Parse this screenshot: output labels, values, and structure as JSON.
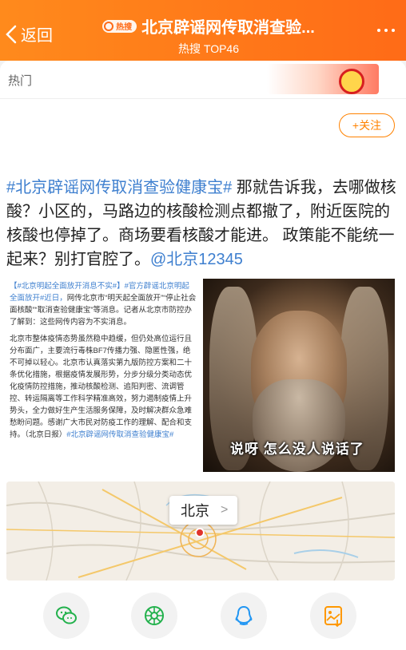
{
  "header": {
    "back_label": "返回",
    "hot_badge": "热搜",
    "title": "北京辟谣网传取消查验...",
    "subtitle": "热搜 TOP46",
    "bg_color": "#ff7a1a"
  },
  "tag_row": {
    "label": "热门"
  },
  "follow_label": "+关注",
  "post": {
    "hashtag": "#北京辟谣网传取消查验健康宝#",
    "body": " 那就告诉我，去哪做核酸？小区的，马路边的核酸检测点都撤了，附近医院的核酸也停掉了。商场要看核酸才能进。 政策能不能统一起来？别打官腔了。",
    "mention": "@北京12345"
  },
  "screenshot_text": {
    "p1_blue": "【#北京明起全面放开消息不实#】#官方辟谣北京明起全面放开#近日，",
    "p1_rest": "网传北京市“明天起全面放开”“停止社会面核酸”“取消查验健康宝”等消息。记者从北京市防控办了解到：这些网传内容为不实消息。",
    "p2": "北京市整体疫情态势虽然稳中趋缓，但仍处高位运行且分布面广，主要流行毒株BF7传播力强、隐匿性强，绝不可掉以轻心。北京市认真落实第九版防控方案和二十条优化措施，根据疫情发展形势，分步分级分类动态优化疫情防控措施，推动核酸检测、追阳判密、流调管控、转运隔离等工作科学精准高效，努力遏制疫情上升势头，全力做好生产生活服务保障，及时解决群众急难愁盼问题。感谢广大市民对防疫工作的理解、配合和支持。（北京日报）",
    "p2_tag": "#北京辟谣网传取消查验健康宝#"
  },
  "meme_caption": "说呀 怎么没人说话了",
  "location": {
    "label": "北京"
  },
  "share": {
    "items": [
      {
        "icon": "wechat-icon",
        "color": "#22b14c"
      },
      {
        "icon": "moments-icon",
        "color": "#22b14c"
      },
      {
        "icon": "qq-icon",
        "color": "#2196f3"
      },
      {
        "icon": "save-image-icon",
        "color": "#ff9800"
      }
    ]
  }
}
